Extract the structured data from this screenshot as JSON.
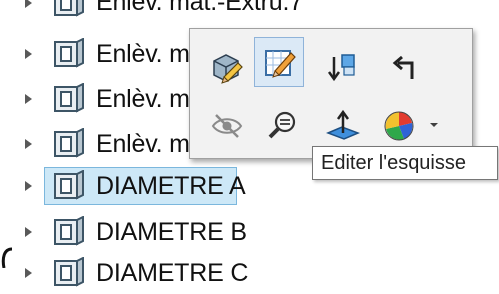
{
  "tree": {
    "items": [
      {
        "label": "Enlev. mat.-Extru.7",
        "selected": false
      },
      {
        "label": "Enlèv. m",
        "selected": false
      },
      {
        "label": "Enlèv. m",
        "selected": false
      },
      {
        "label": "Enlèv. m",
        "selected": false
      },
      {
        "label": "DIAMETRE A",
        "selected": true
      },
      {
        "label": "DIAMETRE B",
        "selected": false
      },
      {
        "label": "DIAMETRE C",
        "selected": false
      }
    ]
  },
  "toolbar": {
    "buttons": [
      {
        "icon": "edit-feature-icon"
      },
      {
        "icon": "edit-sketch-icon",
        "active": true
      },
      {
        "icon": "rollback-icon"
      },
      {
        "icon": "parent-child-icon"
      },
      {
        "icon": "hide-icon"
      },
      {
        "icon": "zoom-to-selection-icon"
      },
      {
        "icon": "normal-to-icon"
      },
      {
        "icon": "appearance-icon"
      }
    ]
  },
  "tooltip": {
    "text": "Editer l'esquisse"
  },
  "colors": {
    "selection_bg": "#cde8f7",
    "selection_border": "#7bb7dd",
    "popup_bg": "#f2f2f2",
    "active_button_bg": "#dbe9f6"
  }
}
